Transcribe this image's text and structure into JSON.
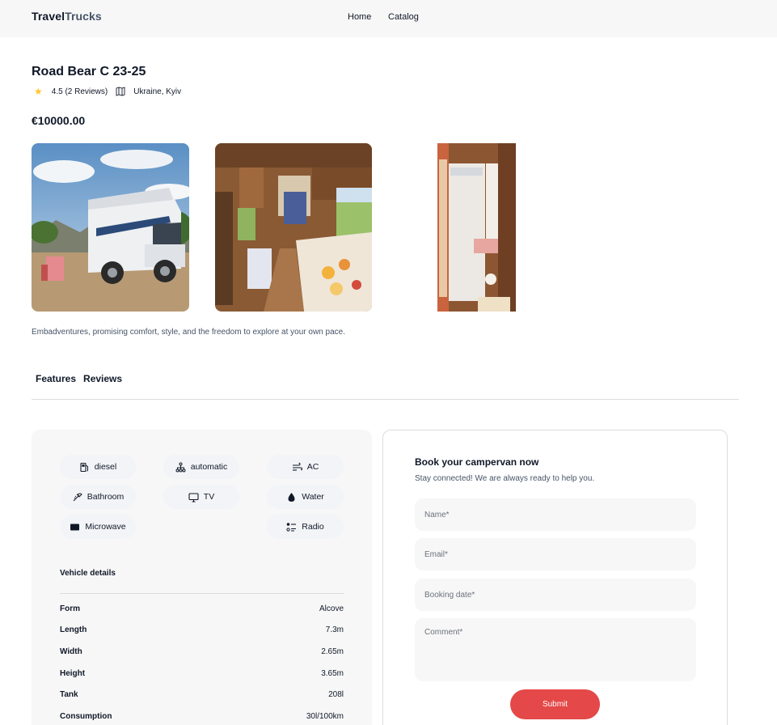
{
  "header": {
    "logo_part1": "Travel",
    "logo_part2": "Trucks",
    "nav": {
      "home": "Home",
      "catalog": "Catalog"
    }
  },
  "camper": {
    "name": "Road Bear C 23-25",
    "rating_text": "4.5 (2 Reviews)",
    "location": "Ukraine, Kyiv",
    "price": "€10000.00",
    "description": "Embadventures, promising comfort, style, and the freedom to explore at your own pace."
  },
  "tabs": {
    "features": "Features",
    "reviews": "Reviews"
  },
  "features": {
    "chips": [
      {
        "label": "diesel",
        "icon": "fuel-pump-icon"
      },
      {
        "label": "automatic",
        "icon": "transmission-icon"
      },
      {
        "label": "AC",
        "icon": "wind-icon"
      },
      {
        "label": "Bathroom",
        "icon": "shower-icon"
      },
      {
        "label": "TV",
        "icon": "tv-icon"
      },
      {
        "label": "Water",
        "icon": "water-drop-icon"
      },
      {
        "label": "Microwave",
        "icon": "microwave-icon"
      },
      {
        "label": "Radio",
        "icon": "radio-icon"
      }
    ],
    "vehicle_details_title": "Vehicle details",
    "details": [
      {
        "key": "Form",
        "value": "Alcove"
      },
      {
        "key": "Length",
        "value": "7.3m"
      },
      {
        "key": "Width",
        "value": "2.65m"
      },
      {
        "key": "Height",
        "value": "3.65m"
      },
      {
        "key": "Tank",
        "value": "208l"
      },
      {
        "key": "Consumption",
        "value": "30l/100km"
      }
    ]
  },
  "booking": {
    "title": "Book your campervan now",
    "subtitle": "Stay connected! We are always ready to help you.",
    "name_placeholder": "Name*",
    "email_placeholder": "Email*",
    "date_placeholder": "Booking date*",
    "comment_placeholder": "Comment*",
    "submit_label": "Submit"
  },
  "colors": {
    "accent": "#e44848",
    "star": "#ffc531",
    "panel_bg": "#f7f7f7",
    "chip_bg": "#f2f4f7",
    "text_main": "#101828",
    "text_muted": "#475467"
  }
}
